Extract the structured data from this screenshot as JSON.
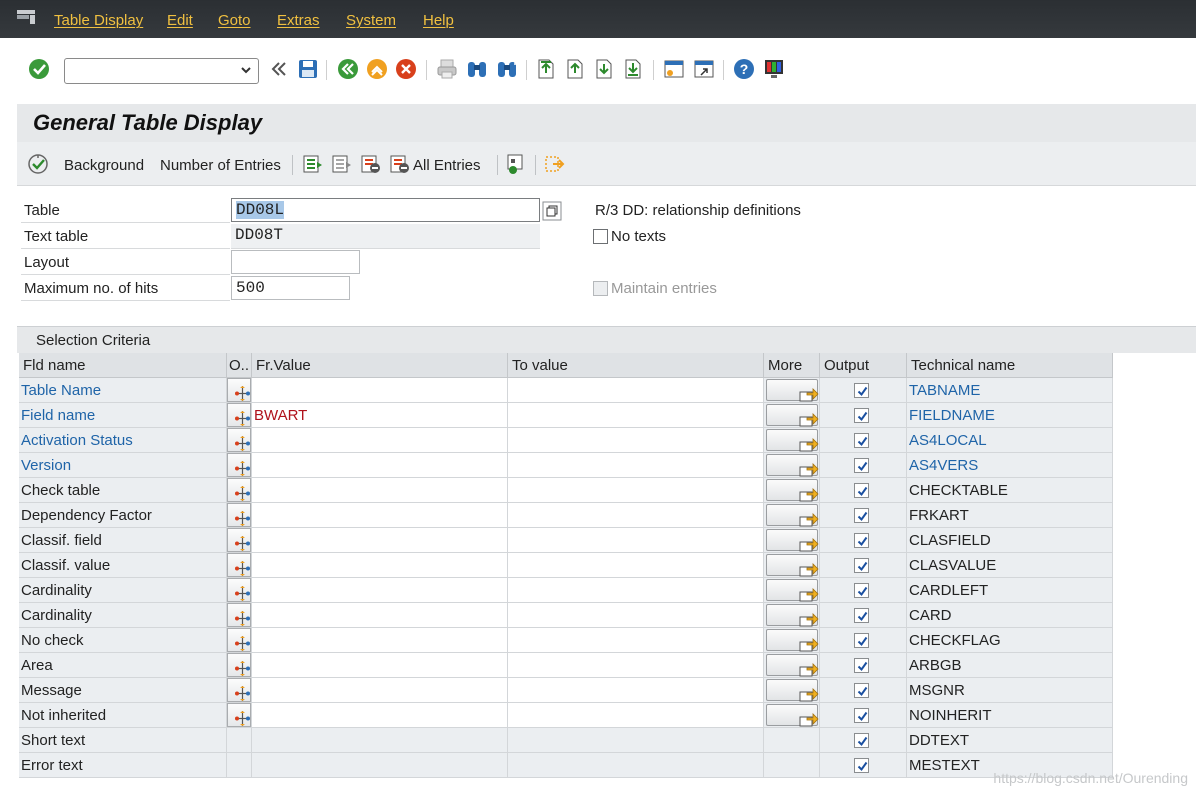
{
  "menubar": {
    "items": [
      "Table Display",
      "Edit",
      "Goto",
      "Extras",
      "System",
      "Help"
    ]
  },
  "toolbar": {
    "command_value": "",
    "icons": [
      "enter-icon",
      "back-double-icon",
      "save-icon",
      "back-icon",
      "exit-icon",
      "cancel-icon",
      "print-icon",
      "find-icon",
      "find-next-icon",
      "first-page-icon",
      "previous-page-icon",
      "next-page-icon",
      "last-page-icon",
      "create-session-icon",
      "create-shortcut-icon",
      "help-icon",
      "customize-layout-icon"
    ]
  },
  "title": "General Table Display",
  "app_toolbar": {
    "background_label": "Background",
    "number_of_entries_label": "Number of Entries",
    "all_entries_label": "All Entries"
  },
  "form": {
    "table_label": "Table",
    "table_value": "DD08L",
    "table_description": "R/3 DD: relationship definitions",
    "text_table_label": "Text table",
    "text_table_value": "DD08T",
    "no_texts_label": "No texts",
    "layout_label": "Layout",
    "layout_value": "",
    "max_hits_label": "Maximum no. of hits",
    "max_hits_value": "500",
    "maintain_entries_label": "Maintain entries"
  },
  "selection": {
    "section_title": "Selection Criteria",
    "columns": {
      "field_name": "Fld name",
      "option": "O..",
      "from_value": "Fr.Value",
      "to_value": "To value",
      "more": "More",
      "output": "Output",
      "technical_name": "Technical name"
    },
    "rows": [
      {
        "name": "Table Name",
        "tech": "TABNAME",
        "from": "",
        "key": true,
        "has_buttons": true
      },
      {
        "name": "Field name",
        "tech": "FIELDNAME",
        "from": "BWART",
        "key": true,
        "has_buttons": true
      },
      {
        "name": "Activation Status",
        "tech": "AS4LOCAL",
        "from": "",
        "key": true,
        "has_buttons": true
      },
      {
        "name": "Version",
        "tech": "AS4VERS",
        "from": "",
        "key": true,
        "has_buttons": true
      },
      {
        "name": "Check table",
        "tech": "CHECKTABLE",
        "from": "",
        "key": false,
        "has_buttons": true
      },
      {
        "name": "Dependency Factor",
        "tech": "FRKART",
        "from": "",
        "key": false,
        "has_buttons": true
      },
      {
        "name": "Classif. field",
        "tech": "CLASFIELD",
        "from": "",
        "key": false,
        "has_buttons": true
      },
      {
        "name": "Classif. value",
        "tech": "CLASVALUE",
        "from": "",
        "key": false,
        "has_buttons": true
      },
      {
        "name": "Cardinality",
        "tech": "CARDLEFT",
        "from": "",
        "key": false,
        "has_buttons": true
      },
      {
        "name": "Cardinality",
        "tech": "CARD",
        "from": "",
        "key": false,
        "has_buttons": true
      },
      {
        "name": "No check",
        "tech": "CHECKFLAG",
        "from": "",
        "key": false,
        "has_buttons": true
      },
      {
        "name": "Area",
        "tech": "ARBGB",
        "from": "",
        "key": false,
        "has_buttons": true
      },
      {
        "name": "Message",
        "tech": "MSGNR",
        "from": "",
        "key": false,
        "has_buttons": true
      },
      {
        "name": "Not inherited",
        "tech": "NOINHERIT",
        "from": "",
        "key": false,
        "has_buttons": true
      },
      {
        "name": "Short text",
        "tech": "DDTEXT",
        "from": "",
        "key": false,
        "has_buttons": false
      },
      {
        "name": "Error text",
        "tech": "MESTEXT",
        "from": "",
        "key": false,
        "has_buttons": false
      }
    ]
  },
  "watermark": "https://blog.csdn.net/Ourending",
  "colors": {
    "key_field": "#1f64a8",
    "from_value": "#b0121c",
    "menu_text": "#f0c040",
    "menubar_bg": "#2b2f33"
  }
}
